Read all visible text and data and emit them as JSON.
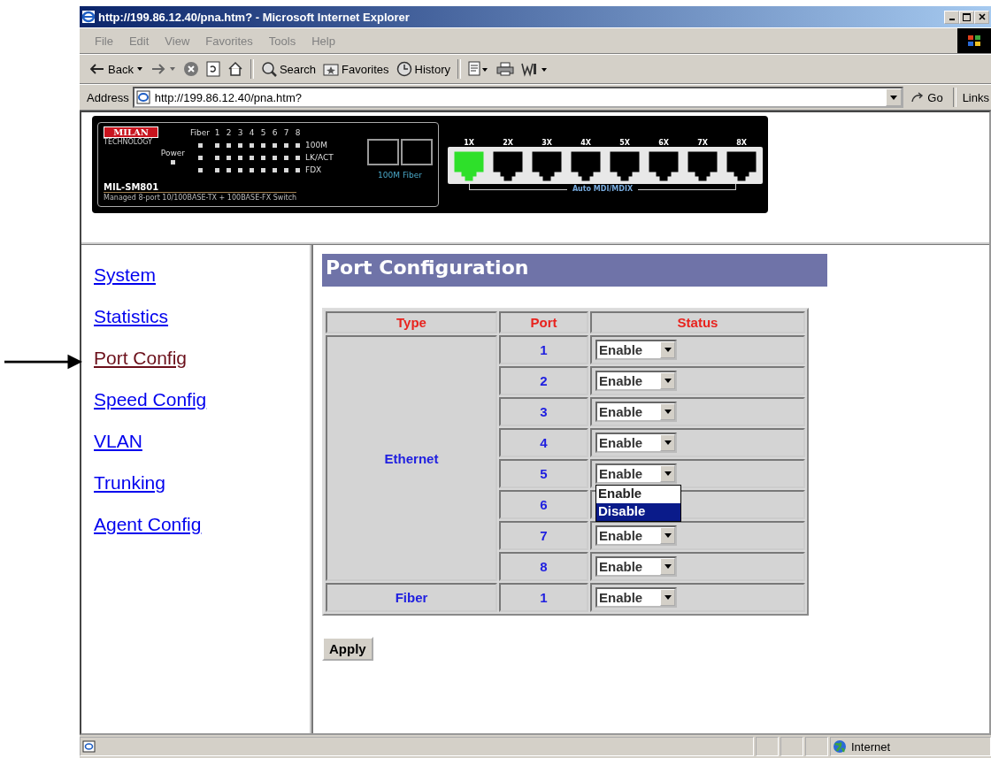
{
  "window": {
    "title": "http://199.86.12.40/pna.htm? - Microsoft Internet Explorer"
  },
  "menu": [
    "File",
    "Edit",
    "View",
    "Favorites",
    "Tools",
    "Help"
  ],
  "toolbar": [
    {
      "kind": "back",
      "label": "Back"
    },
    {
      "kind": "forward"
    },
    {
      "kind": "stop"
    },
    {
      "kind": "refresh"
    },
    {
      "kind": "home"
    },
    {
      "kind": "search",
      "label": "Search"
    },
    {
      "kind": "favorites",
      "label": "Favorites"
    },
    {
      "kind": "history",
      "label": "History"
    },
    {
      "kind": "edit"
    },
    {
      "kind": "print"
    },
    {
      "kind": "word"
    }
  ],
  "address_bar": {
    "label": "Address",
    "value": "http://199.86.12.40/pna.htm?",
    "go": "Go",
    "links": "Links"
  },
  "banner": {
    "logo": "MILAN",
    "logo_sub": "TECHNOLOGY",
    "led_columns": [
      "Fiber",
      "1",
      "2",
      "3",
      "4",
      "5",
      "6",
      "7",
      "8"
    ],
    "led_rows": [
      "100M",
      "LK/ACT",
      "FDX"
    ],
    "power": "Power",
    "model": "MIL-SM801",
    "description": "Managed 8-port 10/100BASE-TX + 100BASE-FX Switch",
    "fiber_label": "100M Fiber",
    "ports": [
      {
        "label": "1X",
        "link": true
      },
      {
        "label": "2X",
        "link": false
      },
      {
        "label": "3X",
        "link": false
      },
      {
        "label": "4X",
        "link": false
      },
      {
        "label": "5X",
        "link": false
      },
      {
        "label": "6X",
        "link": false
      },
      {
        "label": "7X",
        "link": false
      },
      {
        "label": "8X",
        "link": false
      }
    ],
    "port_group_label": "Auto MDI/MDIX"
  },
  "nav": {
    "items": [
      {
        "label": "System",
        "selected": false
      },
      {
        "label": "Statistics",
        "selected": false
      },
      {
        "label": "Port Config",
        "selected": true
      },
      {
        "label": "Speed Config",
        "selected": false
      },
      {
        "label": "VLAN",
        "selected": false
      },
      {
        "label": "Trunking",
        "selected": false
      },
      {
        "label": "Agent Config",
        "selected": false
      }
    ]
  },
  "heading": "Port Configuration",
  "table": {
    "columns": [
      "Type",
      "Port",
      "Status"
    ],
    "groups": [
      {
        "type": "Ethernet",
        "ports": [
          {
            "port": "1",
            "status": "Enable"
          },
          {
            "port": "2",
            "status": "Enable"
          },
          {
            "port": "3",
            "status": "Enable"
          },
          {
            "port": "4",
            "status": "Enable"
          },
          {
            "port": "5",
            "status": "Enable",
            "options": [
              {
                "label": "Enable",
                "selected": false
              },
              {
                "label": "Disable",
                "selected": true
              }
            ]
          },
          {
            "port": "6"
          },
          {
            "port": "7",
            "status": "Enable"
          },
          {
            "port": "8",
            "status": "Enable"
          }
        ]
      },
      {
        "type": "Fiber",
        "ports": [
          {
            "port": "1",
            "status": "Enable"
          }
        ]
      }
    ]
  },
  "apply": "Apply",
  "status_bar": {
    "zone": "Internet"
  }
}
